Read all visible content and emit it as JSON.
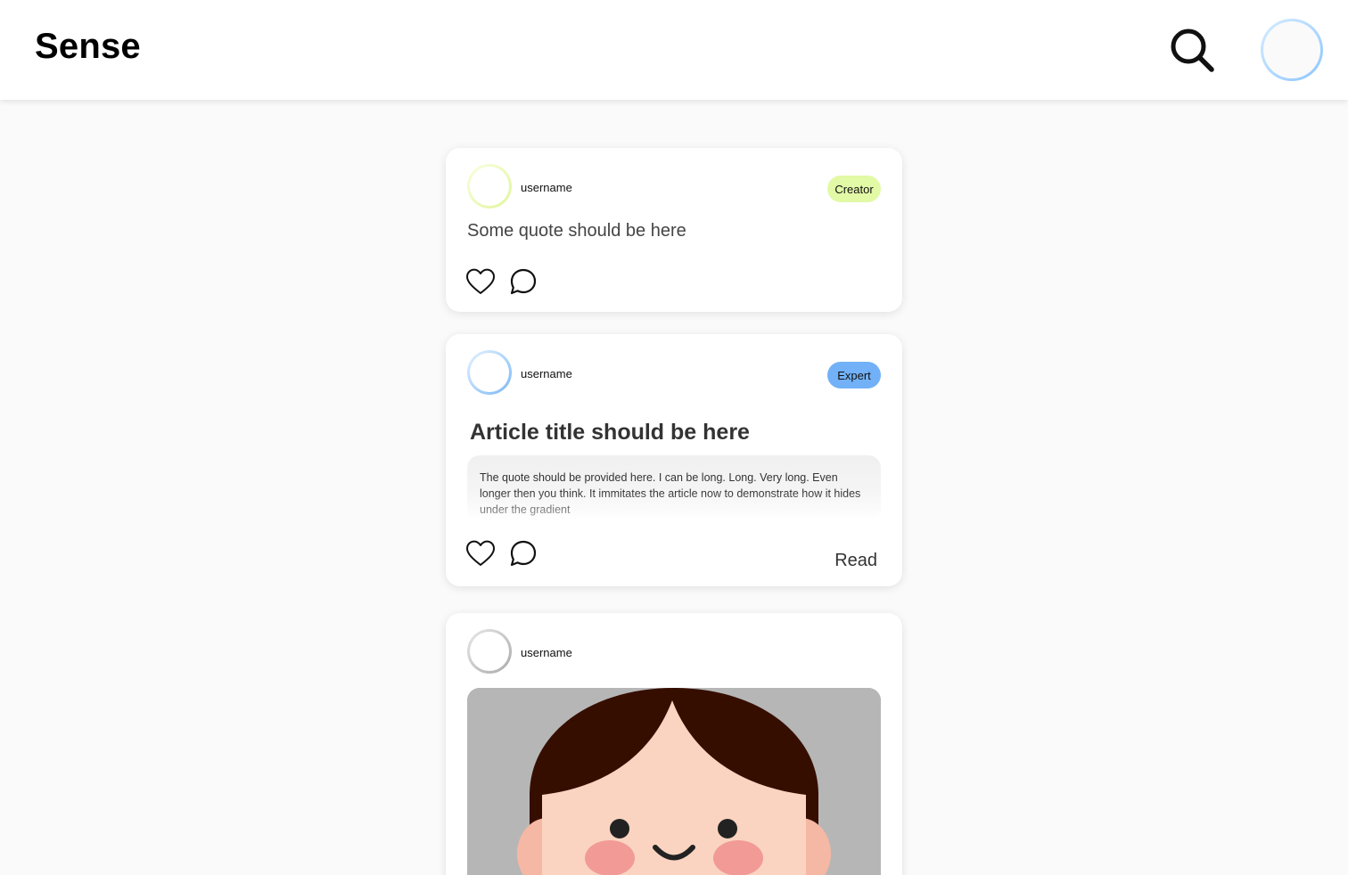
{
  "app": {
    "title": "Sense"
  },
  "header": {
    "search_icon": "search-icon",
    "profile_avatar": "profile-avatar"
  },
  "colors": {
    "creator_badge": "#e2f9a6",
    "expert_badge": "#72b1f7",
    "image_background": "#b6b6b6"
  },
  "feed": {
    "posts": [
      {
        "username": "username",
        "badge": "Creator",
        "quote": "Some quote should be here",
        "icons": [
          "heart-icon",
          "comment-icon"
        ]
      },
      {
        "username": "username",
        "badge": "Expert",
        "title": "Article title should be here",
        "excerpt": "The quote should be provided here. I can be long. Long. Very long. Even longer then you think. It immitates the article now to demonstrate how it hides under the gradient",
        "read_label": "Read",
        "icons": [
          "heart-icon",
          "comment-icon"
        ]
      },
      {
        "username": "username",
        "image": "cartoon-face-illustration"
      }
    ]
  }
}
